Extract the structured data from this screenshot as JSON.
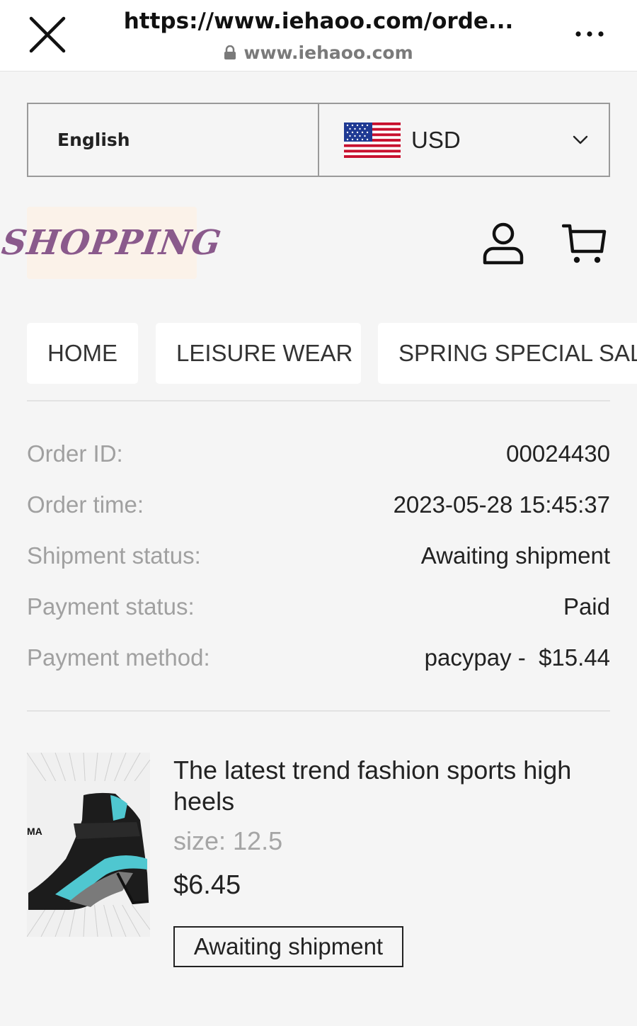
{
  "browser": {
    "url_title": "https://www.iehaoo.com/orde...",
    "domain": "www.iehaoo.com",
    "close_icon": "close-icon",
    "more_icon": "more-horizontal-icon"
  },
  "settings": {
    "language": "English",
    "currency": "USD",
    "currency_flag": "us-flag-icon"
  },
  "header": {
    "logo_text": "SHOPPING",
    "account_icon": "user-icon",
    "cart_icon": "cart-icon"
  },
  "nav": {
    "items": [
      {
        "label": "HOME"
      },
      {
        "label": "LEISURE WEAR"
      },
      {
        "label": "SPRING SPECIAL SALE"
      }
    ]
  },
  "order": {
    "rows": [
      {
        "label": "Order ID:",
        "value": "00024430"
      },
      {
        "label": "Order time:",
        "value": "2023-05-28 15:45:37"
      },
      {
        "label": "Shipment status:",
        "value": "Awaiting shipment"
      },
      {
        "label": "Payment status:",
        "value": "Paid"
      },
      {
        "label": "Payment method:",
        "value": "pacypay -  $15.44"
      }
    ]
  },
  "product": {
    "title": "The latest trend fashion sports high heels",
    "size": "size: 12.5",
    "price": "$6.45",
    "status": "Awaiting shipment",
    "image_brand": "MA"
  },
  "colors": {
    "accent_teal": "#4fc7d0",
    "logo_purple": "#8a5a8c"
  }
}
